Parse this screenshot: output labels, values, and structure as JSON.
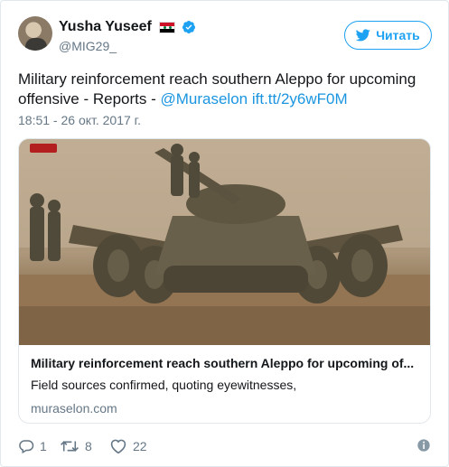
{
  "user": {
    "name": "Yusha Yuseef",
    "handle": "@MIG29_"
  },
  "read_button": {
    "label": "Читать"
  },
  "tweet": {
    "text_plain": "Military reinforcement reach southern Aleppo for upcoming offensive - Reports - ",
    "mention": "@Muraselon",
    "short_link": "ift.tt/2y6wF0M",
    "timestamp": "18:51 - 26 окт. 2017 г."
  },
  "card": {
    "title": "Military reinforcement reach southern Aleppo for upcoming of...",
    "description": "Field sources confirmed, quoting eyewitnesses,",
    "domain": "muraselon.com"
  },
  "actions": {
    "replies": "1",
    "retweets": "8",
    "likes": "22"
  },
  "colors": {
    "link": "#1b95e0",
    "accent": "#1da1f2",
    "muted": "#657786",
    "text": "#14171a"
  },
  "icons": [
    "verified-icon",
    "twitter-bird-icon",
    "reply-icon",
    "retweet-icon",
    "like-icon",
    "info-icon",
    "flag-icon"
  ]
}
